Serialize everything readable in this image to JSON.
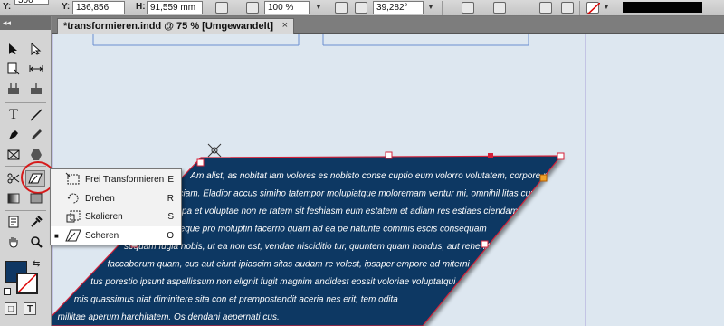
{
  "control_bar": {
    "x_value": "136,856 mm",
    "y_label": "Y:",
    "h_label": "H:",
    "h_value": "91,559 mm",
    "x_top_partial": "500",
    "scale_value": "100 %",
    "shear_value": "39,282°"
  },
  "document": {
    "tab_title": "*transformieren.indd @ 75 % [Umgewandelt]",
    "close_glyph": "×"
  },
  "tools_header": "◂◂",
  "canvas": {
    "text_lines": [
      "Am alist, as nobitat lam volores es nobisto conse cuptio eum volorro volutatem, corpore pratur",
      "aciam. Eladior accus simiho tatempor molupiatque moloremam ventur mi, omnihil litas cum si",
      "ex ea pa et voluptae non re ratem sit feshiasm eum estatem et adiam res estiaes ciendam imus moluptas",
      "num conseque pro moluptin facerrio quam ad ea pe natunte commis escis consequam",
      "sequam fugia nobis, ut ea non est, vendae nisciditio tur, quuntem quam hondus, aut rehenit",
      "faccaborum quam, cus aut eiunt ipiascim sitas audam re volest, ipsaper empore ad miterni",
      "tus porestio ipsunt aspellissum non elignit fugit magnim andidest eossit voloriae voluptatqui",
      "mis quassimus niat diminitere sita con et prempostendit aceria nes erit, tem odita",
      "millitae aperum harchitatem. Os dendani aepernati cus."
    ]
  },
  "context_menu": {
    "items": [
      {
        "label": "Frei Transformieren",
        "shortcut": "E",
        "bullet": "",
        "icon": "free-transform-icon"
      },
      {
        "label": "Drehen",
        "shortcut": "R",
        "bullet": "",
        "icon": "rotate-icon"
      },
      {
        "label": "Skalieren",
        "shortcut": "S",
        "bullet": "",
        "icon": "scale-icon"
      },
      {
        "label": "Scheren",
        "shortcut": "O",
        "bullet": "■",
        "icon": "shear-icon"
      }
    ]
  },
  "colors": {
    "text_frame_fill": "#0f3763",
    "frame_border": "#d4223a",
    "menu_background": "#f2f2f2",
    "canvas_background": "#dde7f0",
    "highlight_circle": "#d61a1a"
  }
}
